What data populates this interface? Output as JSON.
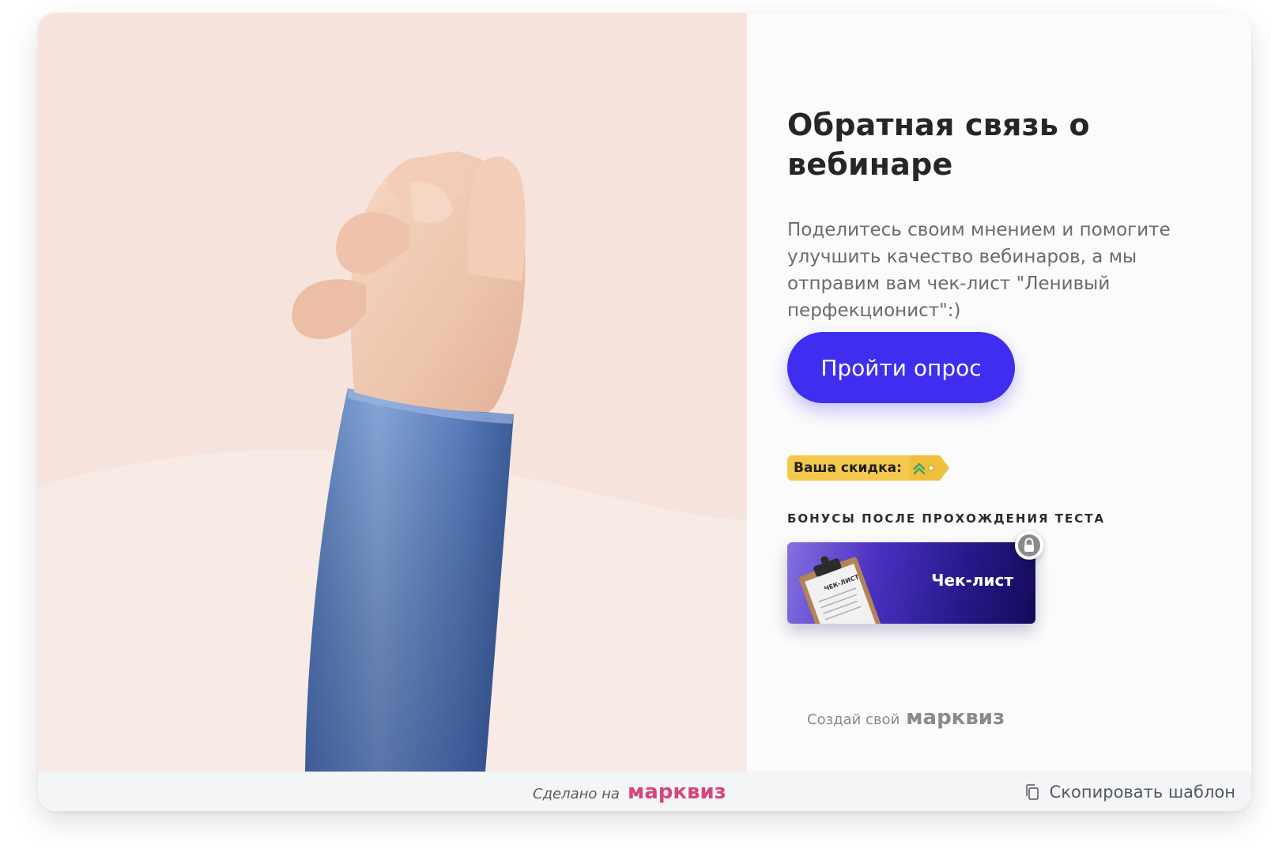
{
  "survey": {
    "title": "Обратная связь о вебинаре",
    "description": "Поделитесь своим мнением и помогите улучшить качество вебинаров, а мы отправим вам чек-лист \"Ленивый перфекционист\":)",
    "cta_label": "Пройти опрос"
  },
  "discount": {
    "label": "Ваша скидка:",
    "icon": "double-chevron-up-icon"
  },
  "bonuses": {
    "heading": "БОНУСЫ ПОСЛЕ ПРОХОЖДЕНИЯ ТЕСТА",
    "items": [
      {
        "title": "Чек-лист",
        "icon": "clipboard-icon",
        "locked": true,
        "image_text": "ЧЕК-ЛИСТ"
      }
    ]
  },
  "branding": {
    "create_own_text": "Создай свой",
    "brand_name": "марквиз"
  },
  "footer": {
    "made_on_text": "Сделано на",
    "brand_name": "марквиз",
    "copy_template_label": "Скопировать шаблон",
    "copy_icon": "copy-icon"
  },
  "colors": {
    "accent": "#3f2df0",
    "brand_pink": "#d8447f",
    "discount_yellow": "#f4c84a",
    "hero_bg": "#f6e4dc"
  }
}
